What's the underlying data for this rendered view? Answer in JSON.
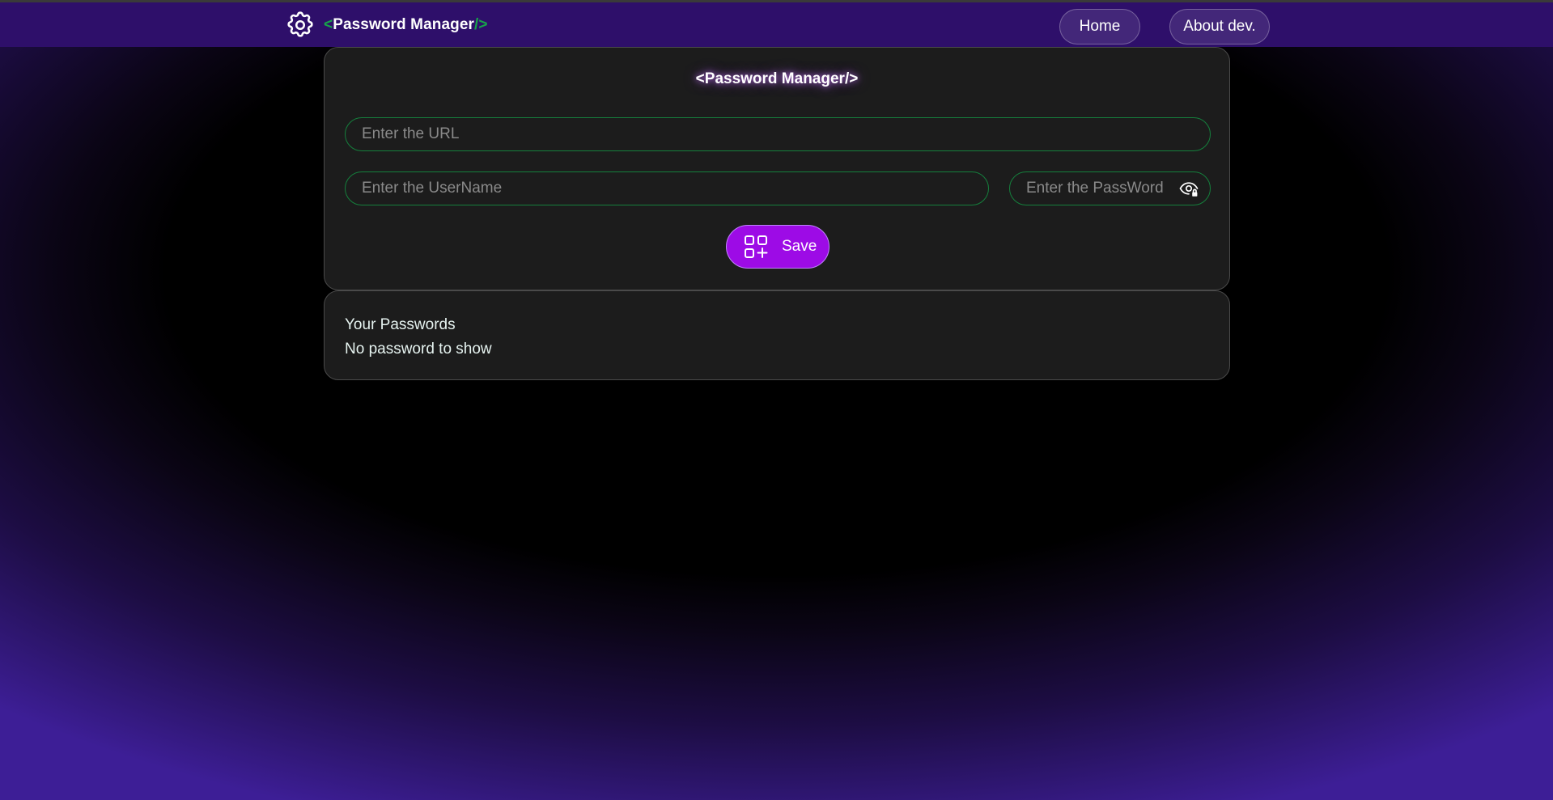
{
  "navbar": {
    "brand_open": "<",
    "brand_name": "Password Manager",
    "brand_close": "/>",
    "links": [
      {
        "label": "Home"
      },
      {
        "label": "About dev."
      }
    ]
  },
  "form": {
    "title": "<Password Manager/>",
    "url": {
      "value": "",
      "placeholder": "Enter the URL"
    },
    "username": {
      "value": "",
      "placeholder": "Enter the UserName"
    },
    "password": {
      "value": "",
      "placeholder": "Enter the PassWord",
      "toggle_icon": "eye-lock-icon"
    },
    "save_label": "Save",
    "save_icon": "grid-add-icon"
  },
  "passwords": {
    "title": "Your Passwords",
    "empty_text": "No password to show"
  },
  "colors": {
    "navbar": "#2e0f6a",
    "accent_green": "#17a34a",
    "field_border": "#15803d",
    "save_button": "#9d0be6",
    "card": "#1c1c1c"
  }
}
